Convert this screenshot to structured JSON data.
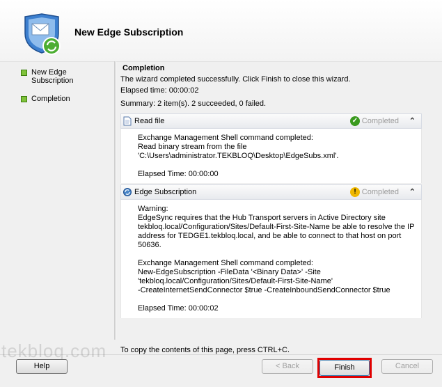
{
  "wizard": {
    "title": "New Edge Subscription"
  },
  "nav": {
    "items": [
      {
        "label_line1": "New Edge",
        "label_line2": "Subscription"
      },
      {
        "label": "Completion"
      }
    ]
  },
  "content": {
    "heading": "Completion",
    "intro": "The wizard completed successfully. Click Finish to close this wizard.",
    "elapsed": "Elapsed time: 00:00:02",
    "summary": "Summary: 2 item(s). 2 succeeded, 0 failed."
  },
  "sections": [
    {
      "title": "Read file",
      "status": "Completed",
      "status_icon": "success-check-icon",
      "lines": [
        "Exchange Management Shell command completed:",
        "Read binary stream from the file",
        "'C:\\Users\\administrator.TEKBLOQ\\Desktop\\EdgeSubs.xml'.",
        "",
        "Elapsed Time: 00:00:00"
      ]
    },
    {
      "title": "Edge Subscription",
      "status": "Completed",
      "status_icon": "warning-icon",
      "lines": [
        "Warning:",
        "EdgeSync requires that the Hub Transport servers in Active Directory site",
        "tekbloq.local/Configuration/Sites/Default-First-Site-Name be able to resolve the IP",
        "address for TEDGE1.tekbloq.local, and be able to connect to that host on port",
        "50636.",
        "",
        "Exchange Management Shell command completed:",
        "New-EdgeSubscription -FileData '<Binary Data>' -Site",
        "'tekbloq.local/Configuration/Sites/Default-First-Site-Name'",
        "-CreateInternetSendConnector $true -CreateInboundSendConnector $true",
        "",
        "Elapsed Time: 00:00:02"
      ]
    }
  ],
  "footer": {
    "copy_hint": "To copy the contents of this page, press CTRL+C.",
    "help": "Help",
    "back": "< Back",
    "finish": "Finish",
    "cancel": "Cancel"
  },
  "watermark": "tekbloq.com",
  "colors": {
    "highlight": "#e00000",
    "success": "#3a9a1e",
    "warning": "#f0b800",
    "nav_bullet": "#7fc23a"
  }
}
